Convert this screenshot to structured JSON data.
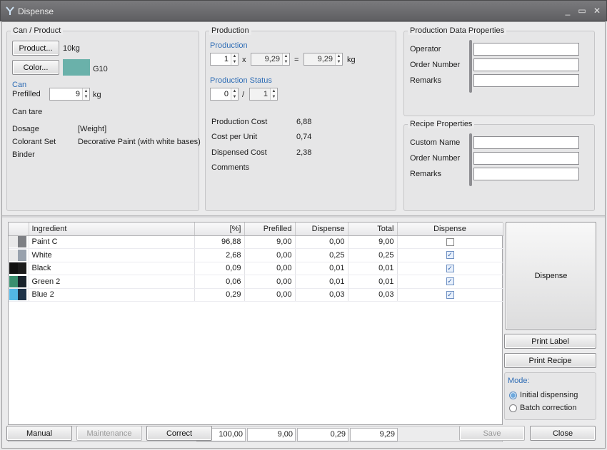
{
  "window": {
    "title": "Dispense",
    "controls": [
      "_",
      "▭",
      "✕"
    ]
  },
  "can_product": {
    "legend": "Can / Product",
    "product_button": "Product...",
    "product_value": "10kg",
    "color_button": "Color...",
    "color_swatch": "#6ab1aa",
    "color_value": "G10",
    "can_heading": "Can",
    "prefilled_label": "Prefilled",
    "prefilled_value": "9",
    "prefilled_unit": "kg",
    "can_tare_label": "Can tare",
    "dosage_label": "Dosage",
    "dosage_value": "[Weight]",
    "colorant_set_label": "Colorant Set",
    "colorant_set_value": "Decorative Paint (with white bases)",
    "binder_label": "Binder"
  },
  "production": {
    "legend": "Production",
    "production_heading": "Production",
    "quantity": "1",
    "times": "x",
    "unit_amount": "9,29",
    "equals": "=",
    "result": "9,29",
    "unit": "kg",
    "status_heading": "Production Status",
    "status_done": "0",
    "status_slash": "/",
    "status_total": "1",
    "cost_label": "Production Cost",
    "cost_value": "6,88",
    "cost_per_unit_label": "Cost per Unit",
    "cost_per_unit_value": "0,74",
    "dispensed_cost_label": "Dispensed Cost",
    "dispensed_cost_value": "2,38",
    "comments_label": "Comments"
  },
  "production_data": {
    "legend": "Production Data Properties",
    "fields": [
      "Operator",
      "Order Number",
      "Remarks"
    ]
  },
  "recipe": {
    "legend": "Recipe Properties",
    "fields": [
      "Custom Name",
      "Order Number",
      "Remarks"
    ]
  },
  "grid": {
    "columns": [
      "Ingredient",
      "[%]",
      "Prefilled",
      "Dispense",
      "Total",
      "Dispense"
    ],
    "rows": [
      {
        "colors": [
          "#e9e9ea",
          "#7d7f84"
        ],
        "name": "Paint C",
        "pct": "96,88",
        "prefilled": "9,00",
        "dispense": "0,00",
        "total": "9,00",
        "checked": false
      },
      {
        "colors": [
          "#e9e9ea",
          "#98a1ad"
        ],
        "name": "White",
        "pct": "2,68",
        "prefilled": "0,00",
        "dispense": "0,25",
        "total": "0,25",
        "checked": true
      },
      {
        "colors": [
          "#111111",
          "#1b1b1b"
        ],
        "name": "Black",
        "pct": "0,09",
        "prefilled": "0,00",
        "dispense": "0,01",
        "total": "0,01",
        "checked": true
      },
      {
        "colors": [
          "#3a8f6f",
          "#18222b"
        ],
        "name": "Green 2",
        "pct": "0,06",
        "prefilled": "0,00",
        "dispense": "0,01",
        "total": "0,01",
        "checked": true
      },
      {
        "colors": [
          "#52b7e6",
          "#1c3148"
        ],
        "name": "Blue 2",
        "pct": "0,29",
        "prefilled": "0,00",
        "dispense": "0,03",
        "total": "0,03",
        "checked": true
      }
    ],
    "totals": {
      "pct": "100,00",
      "prefilled": "9,00",
      "dispense": "0,29",
      "total": "9,29"
    }
  },
  "right_panel": {
    "dispense_button": "Dispense",
    "print_label_button": "Print Label",
    "print_recipe_button": "Print Recipe",
    "mode_label": "Mode:",
    "mode_initial": "Initial dispensing",
    "mode_batch": "Batch correction"
  },
  "footer": {
    "manual": "Manual",
    "maintenance": "Maintenance",
    "correct": "Correct",
    "save": "Save",
    "close": "Close"
  }
}
